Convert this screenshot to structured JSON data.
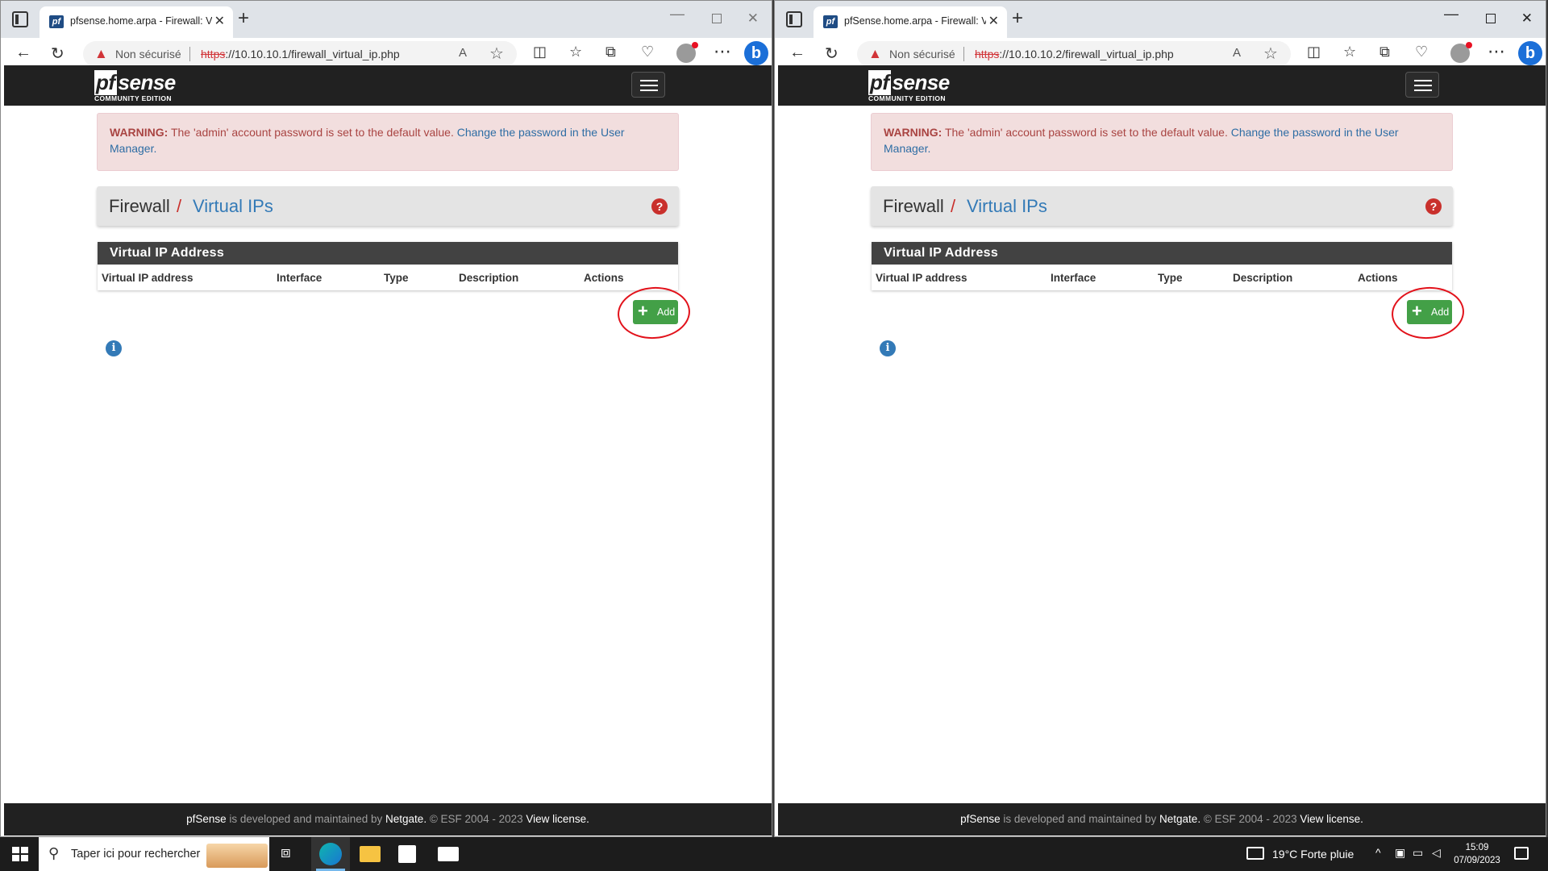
{
  "windows": [
    {
      "tab_title": "pfsense.home.arpa - Firewall: Virtual IPs",
      "security_label": "Non sécurisé",
      "url_scheme": "https",
      "url_rest": "://10.10.10.1/firewall_virtual_ip.php"
    },
    {
      "tab_title": "pfSense.home.arpa - Firewall: Virtual IPs",
      "security_label": "Non sécurisé",
      "url_scheme": "https",
      "url_rest": "://10.10.10.2/firewall_virtual_ip.php"
    }
  ],
  "page": {
    "logo_text": "sense",
    "logo_prefix": "pf",
    "logo_sub": "COMMUNITY EDITION",
    "alert": {
      "label": "WARNING:",
      "message": "The 'admin' account password is set to the default value.",
      "link": "Change the password in the User Manager."
    },
    "breadcrumb": {
      "root": "Firewall",
      "separator": "/",
      "current": "Virtual IPs"
    },
    "panel": {
      "heading": "Virtual IP Address",
      "columns": [
        "Virtual IP address",
        "Interface",
        "Type",
        "Description",
        "Actions"
      ]
    },
    "add_button": "Add",
    "footer": {
      "brand": "pfSense",
      "text1": "is developed and maintained by",
      "vendor": "Netgate.",
      "text2": "© ESF 2004 - 2023",
      "license": "View license."
    }
  },
  "taskbar": {
    "search_placeholder": "Taper ici pour rechercher",
    "weather": "19°C  Forte pluie",
    "time": "15:09",
    "date": "07/09/2023"
  },
  "colors": {
    "header_bg": "#212121",
    "alert_bg": "#f2dede",
    "alert_text": "#a94442",
    "link": "#337ab7",
    "add_button": "#43a047",
    "annotation": "#e2121b"
  },
  "icons": [
    "workspaces-icon",
    "pfsense-favicon",
    "close-icon",
    "plus-icon",
    "back-icon",
    "reload-icon",
    "warning-icon",
    "read-aloud-icon",
    "star-icon",
    "split-screen-icon",
    "favorites-icon",
    "collections-icon",
    "performance-icon",
    "profile-icon",
    "more-icon",
    "bing-icon",
    "menu-icon",
    "help-icon",
    "info-icon",
    "windows-start-icon",
    "search-icon",
    "task-view-icon",
    "edge-icon",
    "file-explorer-icon",
    "store-icon",
    "mail-icon",
    "weather-icon",
    "notification-icon"
  ]
}
